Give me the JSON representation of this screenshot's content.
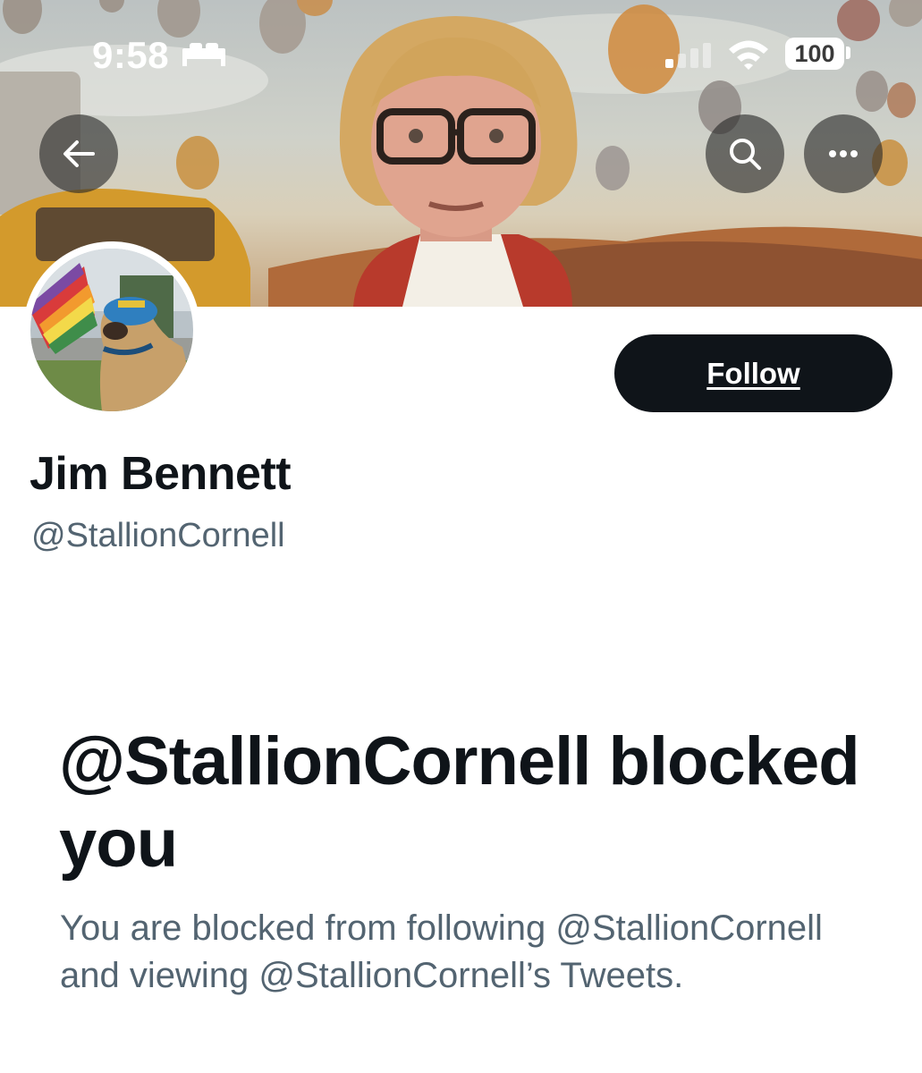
{
  "status_bar": {
    "time": "9:58",
    "battery": "100",
    "icons": [
      "bed-icon",
      "cellular-signal-icon",
      "wifi-icon",
      "battery-icon"
    ]
  },
  "header": {
    "back_icon": "arrow-left-icon",
    "search_icon": "search-icon",
    "more_icon": "more-horizontal-icon"
  },
  "profile": {
    "display_name": "Jim Bennett",
    "handle": "@StallionCornell",
    "follow_label": "Follow"
  },
  "blocked": {
    "title": "@StallionCornell blocked you",
    "description": "You are blocked from following @StallionCornell and viewing @StallionCornell’s Tweets."
  },
  "colors": {
    "primary_text": "#0f1419",
    "secondary_text": "#536471",
    "button_bg": "#0f1419",
    "overlay_button": "#282828"
  }
}
